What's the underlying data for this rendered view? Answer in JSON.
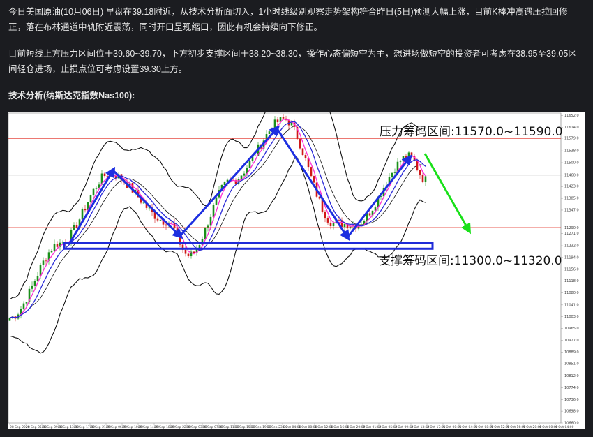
{
  "article": {
    "paragraph1": "今日美国原油(10月06日) 早盘在39.18附近，从技术分析面切入，1小时线级别观察走势架构符合昨日(5日)预测大幅上涨，目前K棒冲高遇压拉回修正，落在布林通道中轨附近震荡，同时开口呈现缩口，因此有机会持续向下修正。",
    "paragraph2": "目前短线上方压力区间位于39.60~39.70，下方初步支撑区间于38.20~38.30，操作心态偏短空为主，想进场做短空的投资者可考虑在38.95至39.05区间轻仓进场，止损点位可考虑设置39.30上方。",
    "heading": "技术分析(纳斯达克指数Nas100):"
  },
  "chart_data": {
    "type": "line",
    "title": "",
    "annotations": {
      "resistance": "压力筹码区间:11570.0~11590.0",
      "support": "支撑筹码区间:11300.0~11320.0"
    },
    "resistance_level": 11579.0,
    "support_level": 11290.0,
    "current_price": 11460.0,
    "ylim": [
      10660,
      11660
    ],
    "y_ticks": [
      "11652.0",
      "11614.0",
      "11579.0",
      "11538.0",
      "11500.0",
      "11460.0",
      "11423.0",
      "11385.0",
      "11347.0",
      "11290.0",
      "11271.0",
      "11232.0",
      "11194.0",
      "11156.0",
      "11118.0",
      "11080.0",
      "11041.0",
      "11003.0",
      "10965.0",
      "10927.0",
      "10889.0",
      "10851.0",
      "10812.0",
      "10774.0",
      "10736.0",
      "10698.0",
      "10660.0"
    ],
    "x_ticks": [
      "28 Sep 2020",
      "28 Sep 05:00",
      "28 Sep 09:00",
      "28 Sep 13:00",
      "28 Sep 17:00",
      "28 Sep 21:00",
      "29 Sep 06:00",
      "29 Sep 10:00",
      "29 Sep 14:00",
      "29 Sep 18:00",
      "29 Sep 22:00",
      "30 Sep 03:00",
      "30 Sep 07:00",
      "30 Sep 11:00",
      "30 Sep 15:00",
      "30 Sep 19:00",
      "30 Sep 23:00",
      "1 Oct 04:00",
      "1 Oct 08:00",
      "1 Oct 12:00",
      "1 Oct 16:00",
      "1 Oct 20:00",
      "2 Oct 01:00",
      "2 Oct 05:00",
      "2 Oct 09:00",
      "2 Oct 13:00",
      "2 Oct 17:00",
      "5 Oct 00:00",
      "5 Oct 04:00",
      "5 Oct 08:00",
      "5 Oct 12:00",
      "5 Oct 16:00",
      "5 Oct 20:00",
      "6 Oct 00:00",
      "6 Oct 04:00"
    ],
    "path_points": [
      11000,
      11240,
      11465,
      11310,
      11200,
      11440,
      11640,
      11305,
      11300,
      11520,
      11445
    ]
  },
  "colors": {
    "resistance_line": "#e0271e",
    "support_box": "#1f2bd8",
    "trend_arrow": "#1d2fe0",
    "forecast_arrow": "#19e019",
    "bollinger": "#111111",
    "ma_fast": "#ff2bd6",
    "ma_slow": "#2a2ad8",
    "bull_candle": "#1a8f1a",
    "bear_candle": "#d01818"
  }
}
